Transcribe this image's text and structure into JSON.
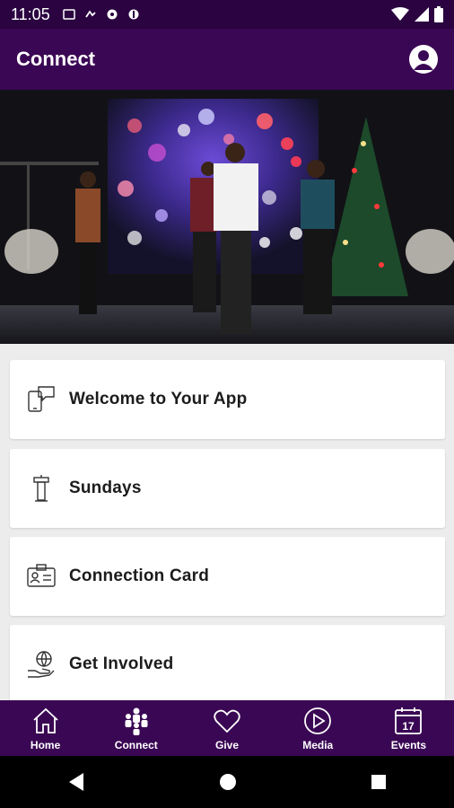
{
  "status": {
    "time": "11:05"
  },
  "app_bar": {
    "title": "Connect"
  },
  "cards": [
    {
      "label": "Welcome to Your App",
      "icon": "chat-phone-icon"
    },
    {
      "label": "Sundays",
      "icon": "podium-icon"
    },
    {
      "label": "Connection Card",
      "icon": "id-card-icon"
    },
    {
      "label": "Get Involved",
      "icon": "globe-hand-icon"
    }
  ],
  "bottom_nav": [
    {
      "label": "Home",
      "icon": "home-icon"
    },
    {
      "label": "Connect",
      "icon": "people-icon"
    },
    {
      "label": "Give",
      "icon": "heart-icon"
    },
    {
      "label": "Media",
      "icon": "play-icon"
    },
    {
      "label": "Events",
      "icon": "calendar-icon"
    }
  ],
  "calendar_day": "17",
  "colors": {
    "brand": "#3a0754",
    "status_bar": "#2a0340",
    "background": "#ececec"
  }
}
